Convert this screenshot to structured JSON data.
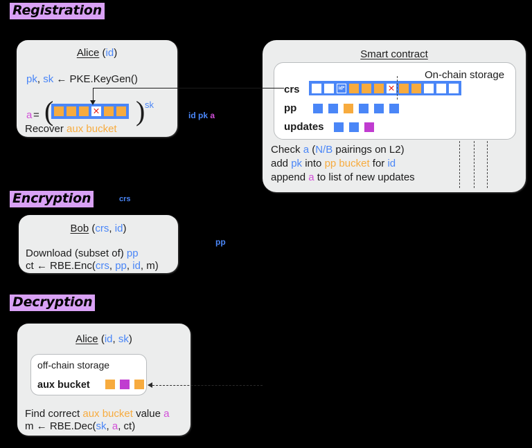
{
  "sections": {
    "registration": "Registration",
    "encryption": "Encryption",
    "decryption": "Decryption"
  },
  "colors": {
    "highlight": "#d9a1f5",
    "blue": "#4a86f7",
    "orange": "#f7ab3e",
    "magenta": "#c03cd0",
    "red": "#e8231c",
    "panel_bg": "#eceded",
    "white": "#ffffff"
  },
  "registration": {
    "alice_panel": {
      "title_name": "Alice",
      "title_args_open": " (",
      "title_id": "id",
      "title_args_close": ")",
      "keygen_pk": "pk",
      "keygen_comma": ", ",
      "keygen_sk": "sk",
      "keygen_rest": " ← PKE.KeyGen()",
      "a_label": "a",
      "eq": " = ",
      "paren_open": "(",
      "paren_close": ")",
      "sk_superscript": "sk",
      "recover_text": "Recover ",
      "recover_aux": "aux bucket",
      "aux_strip": [
        {
          "kind": "orange"
        },
        {
          "kind": "orange"
        },
        {
          "kind": "orange"
        },
        {
          "kind": "xmark"
        },
        {
          "kind": "orange"
        },
        {
          "kind": "orange"
        }
      ]
    },
    "transfer_labels": {
      "id": "id",
      "pk": "pk",
      "a": "a"
    }
  },
  "contract": {
    "title": "Smart contract",
    "onchain_title": "On-chain storage",
    "rows": [
      {
        "label": "crs",
        "kind": "strip",
        "cells": [
          {
            "kind": "white"
          },
          {
            "kind": "white"
          },
          {
            "kind": "blue",
            "text": "id*"
          },
          {
            "kind": "orange"
          },
          {
            "kind": "orange"
          },
          {
            "kind": "orange"
          },
          {
            "kind": "xmark"
          },
          {
            "kind": "orange"
          },
          {
            "kind": "orange"
          },
          {
            "kind": "white"
          },
          {
            "kind": "white"
          },
          {
            "kind": "white"
          }
        ]
      },
      {
        "label": "pp",
        "kind": "squares",
        "cells": [
          {
            "kind": "blue"
          },
          {
            "kind": "blue"
          },
          {
            "kind": "orange"
          },
          {
            "kind": "blue"
          },
          {
            "kind": "blue"
          },
          {
            "kind": "blue"
          }
        ]
      },
      {
        "label": "updates",
        "kind": "squares",
        "cells": [
          {
            "kind": "blue"
          },
          {
            "kind": "blue"
          },
          {
            "kind": "magenta"
          }
        ]
      }
    ],
    "body_lines": [
      {
        "parts": [
          {
            "t": "Check ",
            "c": "dark"
          },
          {
            "t": "a",
            "c": "blue"
          },
          {
            "t": " (",
            "c": "dark"
          },
          {
            "t": "N/B",
            "c": "blue"
          },
          {
            "t": " pairings on L2)",
            "c": "dark"
          }
        ]
      },
      {
        "parts": [
          {
            "t": "add ",
            "c": "dark"
          },
          {
            "t": "pk",
            "c": "blue"
          },
          {
            "t": " into ",
            "c": "dark"
          },
          {
            "t": "pp bucket",
            "c": "orange"
          },
          {
            "t": " for ",
            "c": "dark"
          },
          {
            "t": "id",
            "c": "blue"
          }
        ]
      },
      {
        "parts": [
          {
            "t": "append ",
            "c": "dark"
          },
          {
            "t": "a",
            "c": "magenta"
          },
          {
            "t": " to list of new updates",
            "c": "dark"
          }
        ]
      }
    ]
  },
  "encryption": {
    "crs_label": "crs",
    "pp_label": "pp",
    "bob_panel": {
      "title_name": "Bob",
      "title_open": " (",
      "title_crs": "crs",
      "title_sep": ", ",
      "title_id": "id",
      "title_close": ")",
      "line1_pre": "Download (subset of) ",
      "line1_pp": "pp",
      "line2": [
        {
          "t": "ct ← RBE.Enc(",
          "c": "dark"
        },
        {
          "t": "crs",
          "c": "blue"
        },
        {
          "t": ", ",
          "c": "dark"
        },
        {
          "t": "pp",
          "c": "blue"
        },
        {
          "t": ", ",
          "c": "dark"
        },
        {
          "t": "id",
          "c": "blue"
        },
        {
          "t": ", m)",
          "c": "dark"
        }
      ]
    }
  },
  "decryption": {
    "alice_panel": {
      "title_name": "Alice",
      "title_open": " (",
      "title_id": "id",
      "title_sep": ", ",
      "title_sk": "sk",
      "title_close": ")",
      "offchain_title": "off-chain storage",
      "aux_label": "aux bucket",
      "aux_cells": [
        {
          "kind": "orange"
        },
        {
          "kind": "magenta"
        },
        {
          "kind": "orange"
        }
      ],
      "line1": [
        {
          "t": "Find correct ",
          "c": "dark"
        },
        {
          "t": "aux bucket",
          "c": "orange"
        },
        {
          "t": " value ",
          "c": "dark"
        },
        {
          "t": "a",
          "c": "magenta"
        }
      ],
      "line2": [
        {
          "t": "m ← RBE.Dec(",
          "c": "dark"
        },
        {
          "t": "sk",
          "c": "blue"
        },
        {
          "t": ", ",
          "c": "dark"
        },
        {
          "t": "a",
          "c": "magenta"
        },
        {
          "t": ", ct)",
          "c": "dark"
        }
      ]
    }
  }
}
